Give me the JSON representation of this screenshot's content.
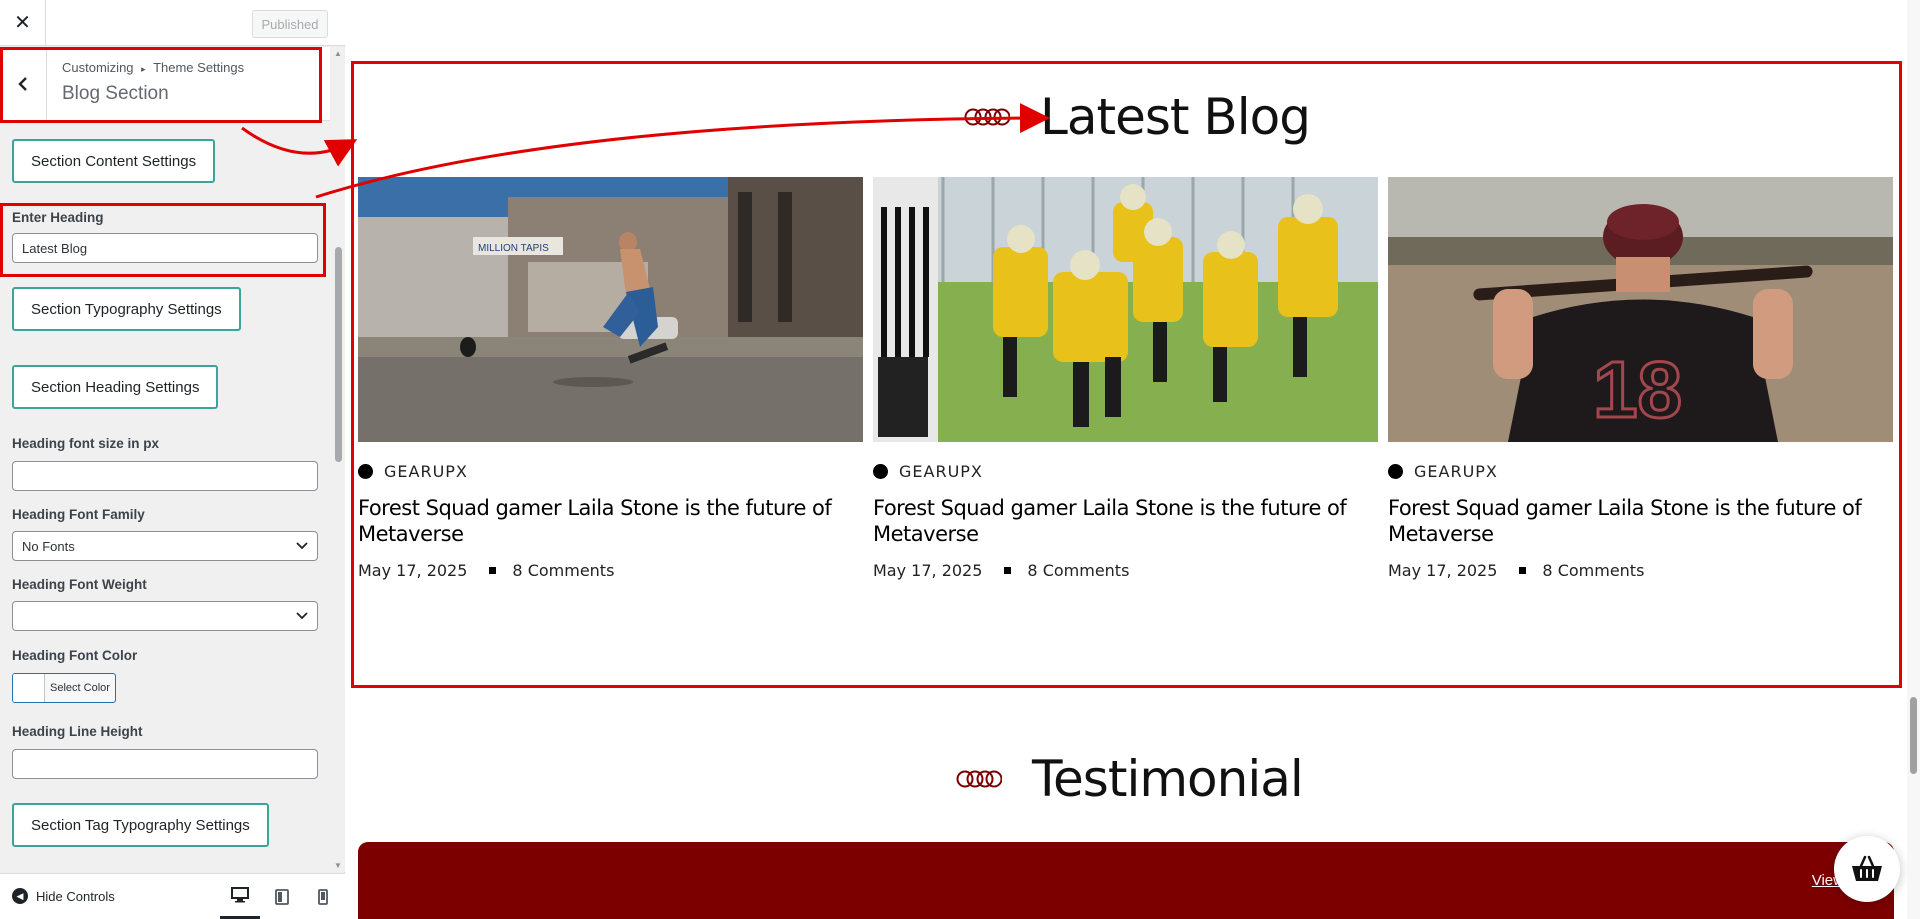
{
  "header": {
    "close_glyph": "✕",
    "published_label": "Published"
  },
  "panel": {
    "breadcrumb_root": "Customizing",
    "breadcrumb_sep": "▸",
    "breadcrumb_parent": "Theme Settings",
    "title": "Blog Section"
  },
  "controls": {
    "content_settings_btn": "Section Content Settings",
    "heading_label": "Enter Heading",
    "heading_value": "Latest Blog",
    "typography_settings_btn": "Section Typography Settings",
    "heading_settings_btn": "Section Heading Settings",
    "font_size_label": "Heading font size in px",
    "font_size_value": "",
    "font_family_label": "Heading Font Family",
    "font_family_value": "No Fonts",
    "font_weight_label": "Heading Font Weight",
    "font_weight_value": "",
    "font_color_label": "Heading Font Color",
    "select_color_label": "Select Color",
    "line_height_label": "Heading Line Height",
    "line_height_value": "",
    "tag_typography_btn": "Section Tag Typography Settings"
  },
  "footer": {
    "hide_controls_label": "Hide Controls",
    "devices": [
      "desktop",
      "tablet",
      "mobile"
    ],
    "active_device": "desktop"
  },
  "preview": {
    "blog_heading": "Latest Blog",
    "posts": [
      {
        "image": "skateboarder-street-photo",
        "category": "GEARUPX",
        "title": "Forest Squad gamer Laila Stone is the future of Metaverse",
        "date": "May 17, 2025",
        "comments": "8 Comments"
      },
      {
        "image": "american-football-players-photo",
        "category": "GEARUPX",
        "title": "Forest Squad gamer Laila Stone is the future of Metaverse",
        "date": "May 17, 2025",
        "comments": "8 Comments"
      },
      {
        "image": "baseball-player-back-photo",
        "category": "GEARUPX",
        "title": "Forest Squad gamer Laila Stone is the future of Metaverse",
        "date": "May 17, 2025",
        "comments": "8 Comments"
      }
    ],
    "testimonial_heading": "Testimonial",
    "view_all_label": "View All"
  },
  "colors": {
    "accent_teal": "#3aa59b",
    "annotation_red": "#e00000",
    "testimonial_bg": "#7d0000",
    "rings": "#7d0000"
  }
}
